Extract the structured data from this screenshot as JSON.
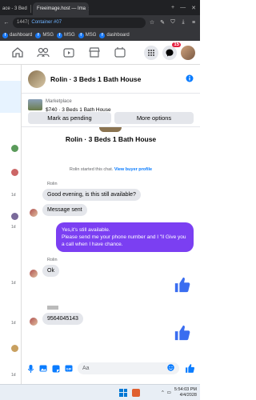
{
  "browser": {
    "tabs": [
      {
        "label": "ace - 3 Bed",
        "active": false
      },
      {
        "label": "Freeimage.host — Ima",
        "active": true
      }
    ],
    "url_text": "1447(",
    "container_label": "Container #07",
    "bookmarks": [
      "dashboard",
      "MSG",
      "MSG",
      "MSG",
      "dashboard"
    ]
  },
  "facebook": {
    "notification_count": "15"
  },
  "sidebar": {
    "times": [
      "1d",
      "1d",
      "1d",
      "1d",
      "1d"
    ]
  },
  "chat": {
    "header_title": "Rolin · 3 Beds 1 Bath House",
    "marketplace_label": "Marketplace",
    "listing_price": "$740 · 3 Beds 1 Bath House",
    "mark_pending_label": "Mark as pending",
    "more_options_label": "More options",
    "conversation_title": "Rolin · 3 Beds 1 Bath House",
    "started_text": "Rolin started this chat.",
    "view_profile_label": "View buyer profile",
    "messages": [
      {
        "sender": "Rolin",
        "text": "Good evening, is this still available?"
      },
      {
        "sender": "",
        "text": "Message sent"
      },
      {
        "sender": "me",
        "text": "Yes,it's still available.\nPlease send me your phone number and I \"ll Give you a call when I have chance."
      },
      {
        "sender": "Rolin",
        "text": "Ok"
      },
      {
        "sender": "",
        "text": "9564045143"
      }
    ],
    "composer_placeholder": "Aa"
  },
  "taskbar": {
    "time": "5:54:03 PM",
    "date": "4/4/2028"
  },
  "colors": {
    "accent": "#0a7cff",
    "outgoing_bubble": "#7b3ff2",
    "badge": "#e41e3f"
  }
}
